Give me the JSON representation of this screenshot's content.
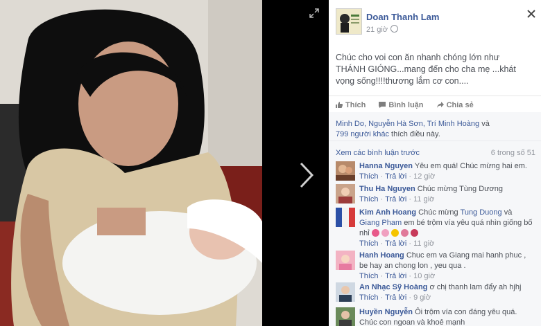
{
  "colors": {
    "link": "#3b5998",
    "meta": "#90949c",
    "text": "#4b4f56",
    "panel_bg": "#f6f7f9"
  },
  "viewer": {
    "photo_alt": "",
    "icons": {
      "next": "chevron-right-icon",
      "expand": "expand-icon",
      "close": "close-icon"
    }
  },
  "post": {
    "page_name": "Doan Thanh Lam",
    "time": "21 giờ",
    "text": "Chúc cho voi con ăn nhanh chóng lớn như THÁNH GIÓNG...mang đến cho cha mẹ ...khát vọng sống!!!!thương lắm cơ con....",
    "actions": {
      "like": "Thích",
      "comment": "Bình luận",
      "share": "Chia sẻ"
    }
  },
  "likes": {
    "names": "Minh Do, Nguyễn Hà Sơn, Trí Minh Hoàng",
    "and": " và",
    "others": "799 người khác",
    "suffix": " thích điều này."
  },
  "comments_header": {
    "view_more": "Xem các bình luận trước",
    "count": "6 trong số 51"
  },
  "comment_actions": {
    "like": "Thích",
    "reply": "Trả lời"
  },
  "comments": [
    {
      "name": "Hanna Nguyen",
      "text": " Yêu em quá! Chúc mừng hai em.",
      "time": "12 giờ"
    },
    {
      "name": "Thu Ha Nguyen",
      "text": " Chúc mừng Tùng Dương",
      "time": "11 giờ"
    },
    {
      "name": "Kim Anh Hoang",
      "text_a": " Chúc mừng ",
      "tag1": "Tung Duong",
      "text_b": " và ",
      "tag2": "Giang Pham",
      "text_c": " em bé trộm vía yêu quá nhìn giống bố nhỉ",
      "time": "11 giờ"
    },
    {
      "name": "Hanh Hoang",
      "text": " Chuc em va Giang mai hanh phuc , be hay an chong lon , yeu qua .",
      "time": "10 giờ"
    },
    {
      "name": "An Nhạc Sỹ Hoàng",
      "text": " ơ chị thanh lam đẩy ah hjhj",
      "time": "9 giờ"
    },
    {
      "name": "Huyền Nguyễn",
      "text": " Ôi trộm vía con đáng yêu quá. Chúc con ngoan và khoẻ mạnh",
      "time": ""
    }
  ]
}
